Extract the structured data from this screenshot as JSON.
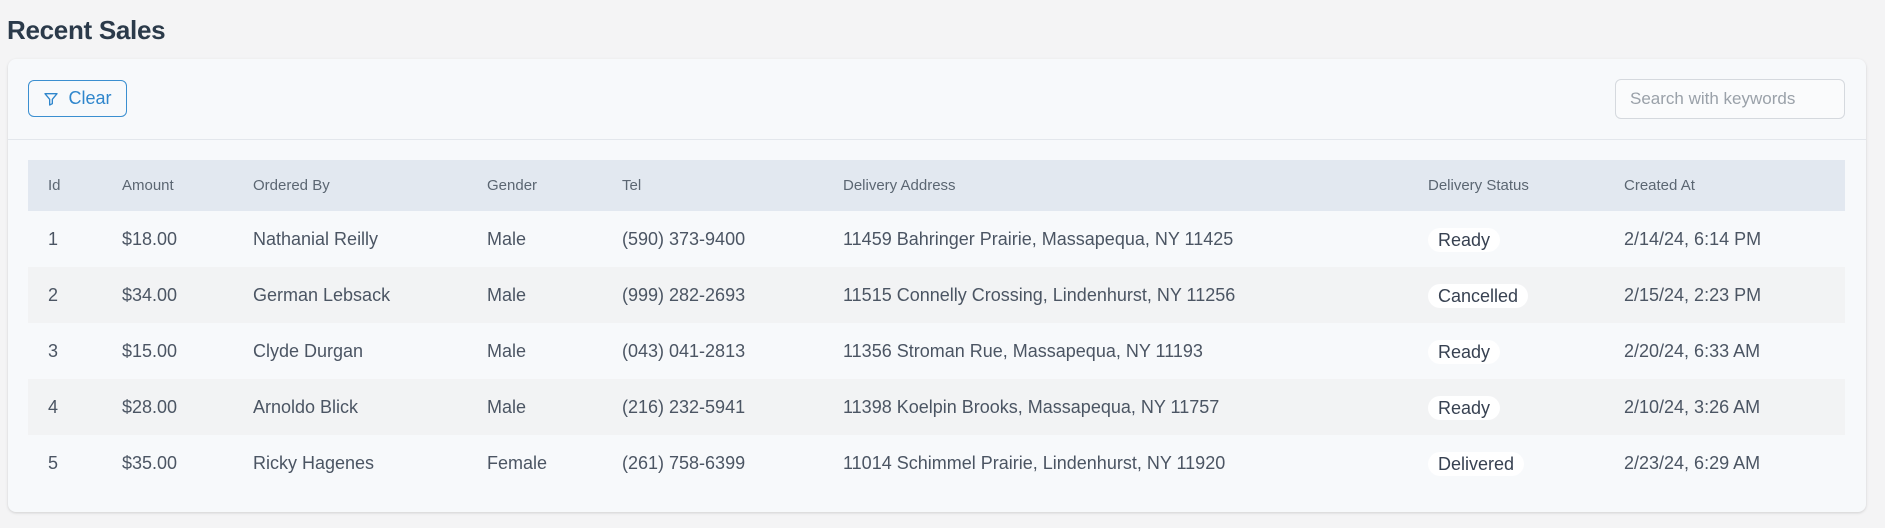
{
  "page": {
    "title": "Recent Sales"
  },
  "toolbar": {
    "clear_label": "Clear",
    "clear_icon": "filter-icon",
    "search_placeholder": "Search with keywords",
    "search_value": ""
  },
  "table": {
    "columns": [
      "Id",
      "Amount",
      "Ordered By",
      "Gender",
      "Tel",
      "Delivery Address",
      "Delivery Status",
      "Created At"
    ],
    "rows": [
      {
        "id": "1",
        "amount": "$18.00",
        "ordered_by": "Nathanial Reilly",
        "gender": "Male",
        "tel": "(590) 373-9400",
        "address": "11459 Bahringer Prairie, Massapequa, NY 11425",
        "status": "Ready",
        "created_at": "2/14/24, 6:14 PM"
      },
      {
        "id": "2",
        "amount": "$34.00",
        "ordered_by": "German Lebsack",
        "gender": "Male",
        "tel": "(999) 282-2693",
        "address": "11515 Connelly Crossing, Lindenhurst, NY 11256",
        "status": "Cancelled",
        "created_at": "2/15/24, 2:23 PM"
      },
      {
        "id": "3",
        "amount": "$15.00",
        "ordered_by": "Clyde Durgan",
        "gender": "Male",
        "tel": "(043) 041-2813",
        "address": "11356 Stroman Rue, Massapequa, NY 11193",
        "status": "Ready",
        "created_at": "2/20/24, 6:33 AM"
      },
      {
        "id": "4",
        "amount": "$28.00",
        "ordered_by": "Arnoldo Blick",
        "gender": "Male",
        "tel": "(216) 232-5941",
        "address": "11398 Koelpin Brooks, Massapequa, NY 11757",
        "status": "Ready",
        "created_at": "2/10/24, 3:26 AM"
      },
      {
        "id": "5",
        "amount": "$35.00",
        "ordered_by": "Ricky Hagenes",
        "gender": "Female",
        "tel": "(261) 758-6399",
        "address": "11014 Schimmel Prairie, Lindenhurst, NY 11920",
        "status": "Delivered",
        "created_at": "2/23/24, 6:29 AM"
      }
    ]
  },
  "colors": {
    "accent": "#2f86cc",
    "header_bg": "#e2e8f0",
    "row_alt_bg": "#f2f3f4",
    "card_bg": "#f7f9fb"
  }
}
